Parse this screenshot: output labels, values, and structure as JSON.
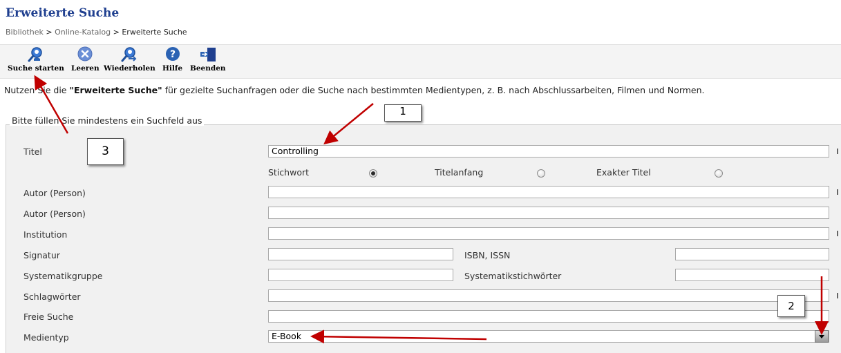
{
  "page_title": "Erweiterte Suche",
  "breadcrumb": [
    "Bibliothek",
    "Online-Katalog",
    "Erweiterte Suche"
  ],
  "breadcrumb_separator": ">",
  "toolbar": [
    {
      "label": "Suche starten",
      "icon": "search-person-icon"
    },
    {
      "label": "Leeren",
      "icon": "clear-x-icon"
    },
    {
      "label": "Wiederholen",
      "icon": "repeat-search-icon"
    },
    {
      "label": "Hilfe",
      "icon": "help-icon"
    },
    {
      "label": "Beenden",
      "icon": "exit-door-icon"
    }
  ],
  "intro": {
    "before": "Nutzen Sie die ",
    "bold": "\"Erweiterte Suche\"",
    "after": " für gezielte Suchanfragen oder die Suche nach bestimmten Medientypen, z. B. nach Abschlussarbeiten, Filmen und Normen."
  },
  "form": {
    "legend": "Bitte füllen Sie mindestens ein Suchfeld aus",
    "titel_label": "Titel",
    "titel_value": "Controlling",
    "title_mode": {
      "options": [
        "Stichwort",
        "Titelanfang",
        "Exakter Titel"
      ],
      "selected": "Stichwort"
    },
    "autor1_label": "Autor (Person)",
    "autor2_label": "Autor (Person)",
    "institution_label": "Institution",
    "signatur_label": "Signatur",
    "isbn_label": "ISBN, ISSN",
    "systematikgruppe_label": "Systematikgruppe",
    "systematikstichwoerter_label": "Systematikstichwörter",
    "schlagwoerter_label": "Schlagwörter",
    "freie_suche_label": "Freie Suche",
    "medientyp_label": "Medientyp",
    "medientyp_value": "E-Book"
  },
  "annotations": {
    "callout_1": "1",
    "callout_2": "2",
    "callout_3": "3",
    "arrow_color": "#c00000"
  },
  "colors": {
    "title": "#1f3f8f",
    "toolbar_icon": "#2b62b3",
    "panel_bg": "#f1f1f1"
  }
}
